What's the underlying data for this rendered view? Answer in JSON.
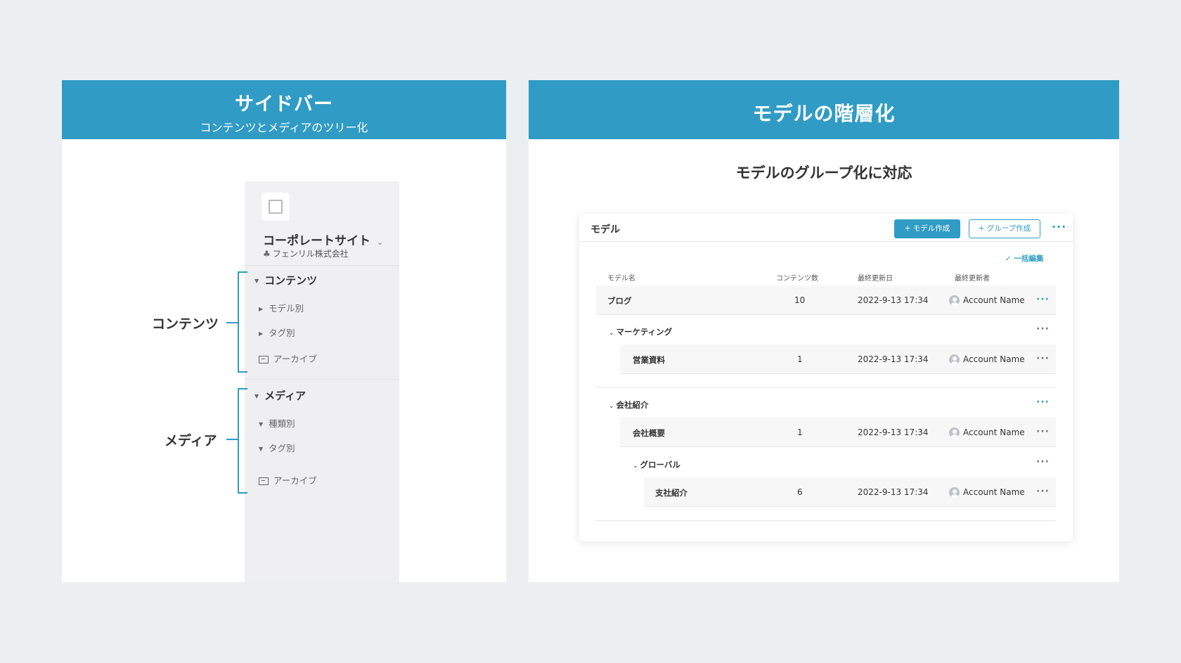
{
  "left_panel": {
    "title": "サイドバー",
    "subtitle": "コンテンツとメディアのツリー化"
  },
  "sidebar": {
    "site_name": "コーポレートサイト",
    "org_name": "フェンリル株式会社",
    "contents": {
      "heading": "コンテンツ",
      "items": [
        "モデル別",
        "タグ別",
        "アーカイブ"
      ]
    },
    "media": {
      "heading": "メディア",
      "items": [
        "種類別",
        "タグ別",
        "アーカイブ"
      ]
    }
  },
  "brackets": {
    "contents_label": "コンテンツ",
    "media_label": "メディア"
  },
  "right_panel": {
    "title": "モデルの階層化",
    "feature_title": "モデルのグループ化に対応"
  },
  "card": {
    "title": "モデル",
    "create_model_button": "+ モデル作成",
    "create_group_button": "+ グループ作成",
    "more_icon": "ellipsis-icon",
    "bulk_edit": "✓ 一括編集",
    "columns": [
      "モデル名",
      "コンテンツ数",
      "最終更新日",
      "最終更新者"
    ],
    "rows": [
      {
        "name": "ブログ",
        "count": "10",
        "date": "2022-9-13 17:34",
        "user": "Account Name"
      },
      {
        "name": "営業資料",
        "count": "1",
        "date": "2022-9-13 17:34",
        "user": "Account Name"
      },
      {
        "name": "会社概要",
        "count": "1",
        "date": "2022-9-13 17:34",
        "user": "Account Name"
      },
      {
        "name": "支社紹介",
        "count": "6",
        "date": "2022-9-13 17:34",
        "user": "Account Name"
      }
    ],
    "groups": [
      "マーケティング",
      "会社紹介",
      "グローバル"
    ]
  },
  "colors": {
    "accent": "#309cc5",
    "background": "#eceff2"
  }
}
